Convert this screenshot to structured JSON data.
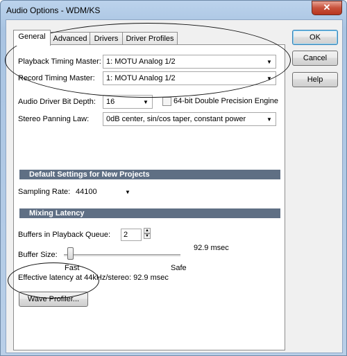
{
  "window": {
    "title": "Audio Options - WDM/KS",
    "close_glyph": "✕"
  },
  "tabs": [
    {
      "label": "General",
      "active": true
    },
    {
      "label": "Advanced",
      "active": false
    },
    {
      "label": "Drivers",
      "active": false
    },
    {
      "label": "Driver Profiles",
      "active": false
    }
  ],
  "general": {
    "playback_timing_label": "Playback Timing Master:",
    "playback_timing_value": "1: MOTU Analog 1/2",
    "record_timing_label": "Record Timing Master:",
    "record_timing_value": "1: MOTU Analog 1/2",
    "bit_depth_label": "Audio Driver Bit Depth:",
    "bit_depth_value": "16",
    "double_precision_label": "64-bit Double Precision Engine",
    "double_precision_checked": false,
    "panning_label": "Stereo Panning Law:",
    "panning_value": "0dB center, sin/cos taper, constant power"
  },
  "defaults_section": {
    "header": "Default Settings for New Projects",
    "sampling_rate_label": "Sampling Rate:",
    "sampling_rate_value": "44100"
  },
  "latency_section": {
    "header": "Mixing Latency",
    "buffers_label": "Buffers in Playback Queue:",
    "buffers_value": "2",
    "buffer_size_label": "Buffer Size:",
    "buffer_size_value": "92.9 msec",
    "buffer_slider_fraction": 0.0,
    "fast_label": "Fast",
    "safe_label": "Safe",
    "effective_latency": "Effective latency at 44kHz/stereo:  92.9 msec",
    "wave_profiler_label": "Wave Profiler..."
  },
  "side_buttons": {
    "ok": "OK",
    "cancel": "Cancel",
    "help": "Help"
  }
}
